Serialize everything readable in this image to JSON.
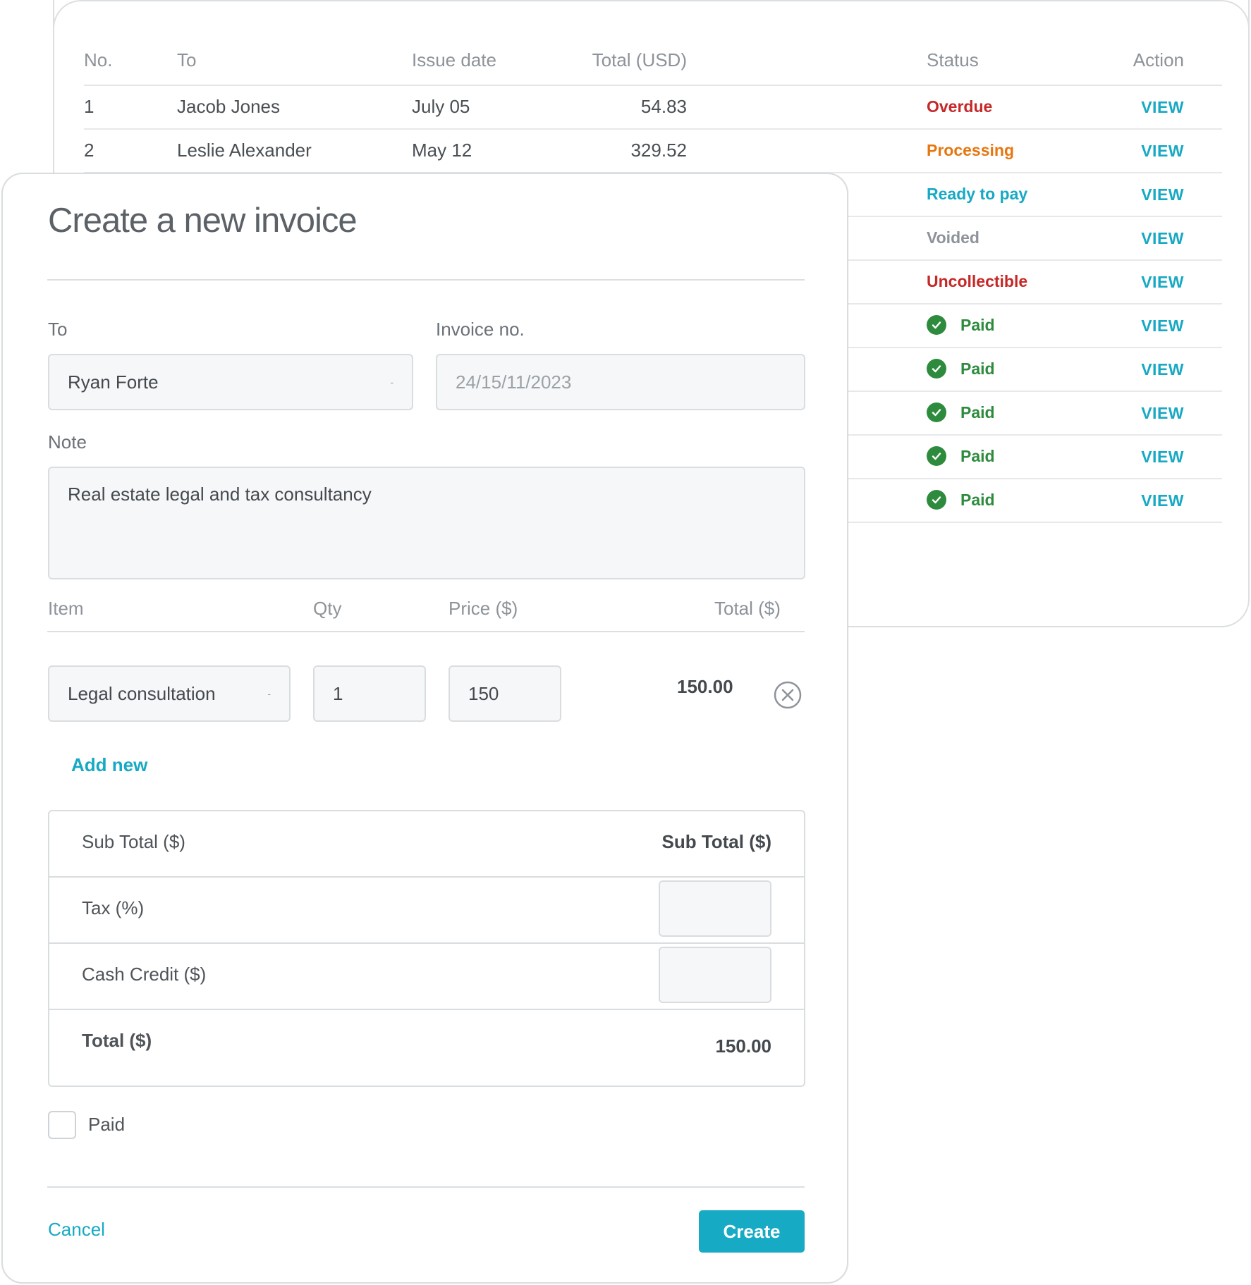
{
  "invoice_list": {
    "headers": {
      "no": "No.",
      "to": "To",
      "issue_date": "Issue date",
      "total": "Total (USD)",
      "status": "Status",
      "action": "Action"
    },
    "rows": [
      {
        "no": "1",
        "to": "Jacob Jones",
        "issue_date": "July 05",
        "total": "54.83",
        "status": "Overdue",
        "status_color": "#c62828",
        "action": "VIEW"
      },
      {
        "no": "2",
        "to": "Leslie Alexander",
        "issue_date": "May 12",
        "total": "329.52",
        "status": "Processing",
        "status_color": "#e67710",
        "action": "VIEW"
      },
      {
        "no": "",
        "to": "",
        "issue_date": "",
        "total": "",
        "status": "Ready to pay",
        "status_color": "#17a9c4",
        "action": "VIEW"
      },
      {
        "no": "",
        "to": "",
        "issue_date": "",
        "total": "",
        "status": "Voided",
        "status_color": "#8d9399",
        "action": "VIEW"
      },
      {
        "no": "",
        "to": "",
        "issue_date": "",
        "total": "",
        "status": "Uncollectible",
        "status_color": "#c62828",
        "action": "VIEW"
      },
      {
        "no": "",
        "to": "",
        "issue_date": "",
        "total": "",
        "status": "Paid",
        "status_color": "#2e8b3e",
        "action": "VIEW",
        "icon": "check-circle-icon"
      },
      {
        "no": "",
        "to": "",
        "issue_date": "",
        "total": "",
        "status": "Paid",
        "status_color": "#2e8b3e",
        "action": "VIEW",
        "icon": "check-circle-icon"
      },
      {
        "no": "",
        "to": "",
        "issue_date": "",
        "total": "",
        "status": "Paid",
        "status_color": "#2e8b3e",
        "action": "VIEW",
        "icon": "check-circle-icon"
      },
      {
        "no": "",
        "to": "",
        "issue_date": "",
        "total": "",
        "status": "Paid",
        "status_color": "#2e8b3e",
        "action": "VIEW",
        "icon": "check-circle-icon"
      },
      {
        "no": "",
        "to": "",
        "issue_date": "",
        "total": "",
        "status": "Paid",
        "status_color": "#2e8b3e",
        "action": "VIEW",
        "icon": "check-circle-icon"
      }
    ]
  },
  "modal": {
    "title": "Create a new invoice",
    "to_label": "To",
    "to_value": "Ryan Forte",
    "invoice_no_label": "Invoice no.",
    "invoice_no_placeholder": "24/15/11/2023",
    "note_label": "Note",
    "note_value": "Real estate legal and tax consultancy",
    "items_header": {
      "item": "Item",
      "qty": "Qty",
      "price": "Price ($)",
      "total": "Total ($)"
    },
    "line_item": {
      "item": "Legal consultation",
      "qty": "1",
      "price": "150",
      "total": "150.00"
    },
    "add_new": "Add new",
    "summary": {
      "subtotal_label": "Sub Total ($)",
      "subtotal_value": "Sub Total ($)",
      "tax_label": "Tax (%)",
      "cash_credit_label": "Cash Credit ($)",
      "total_label": "Total ($)",
      "total_value": "150.00"
    },
    "paid_label": "Paid",
    "paid_checked": false,
    "cancel": "Cancel",
    "create": "Create"
  },
  "colors": {
    "accent": "#17aac5",
    "overdue": "#c62828",
    "processing": "#e67710",
    "paid": "#2e8b3e"
  }
}
